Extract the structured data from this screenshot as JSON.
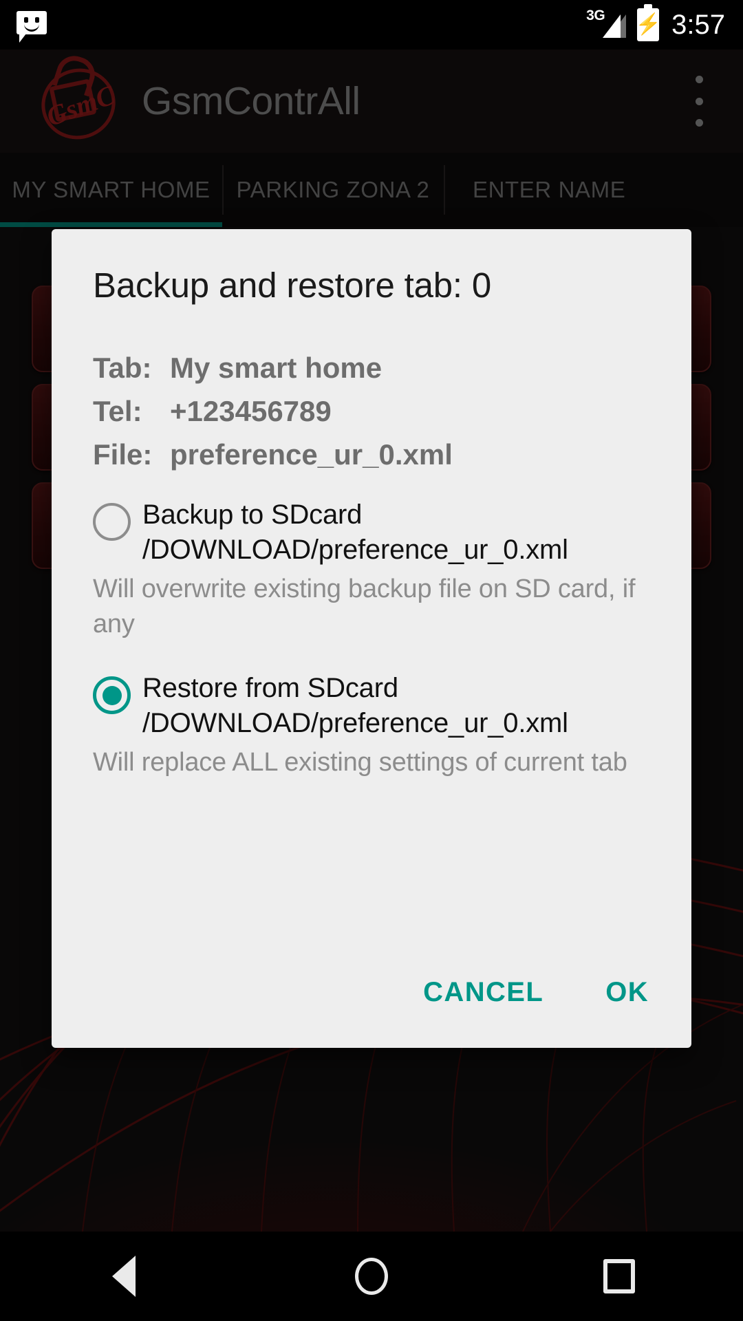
{
  "status_bar": {
    "notification_icon": "sms-icon",
    "network_label": "3G",
    "signal_icon": "signal-bars-icon",
    "battery_icon": "battery-charging-icon",
    "time": "3:57"
  },
  "app_bar": {
    "logo_text": "GsmC",
    "logo_icon": "padlock-logo-icon",
    "title": "GsmContrAll",
    "overflow_icon": "overflow-menu-icon"
  },
  "tabs": {
    "items": [
      {
        "label": "MY SMART HOME",
        "selected": true
      },
      {
        "label": "PARKING ZONA 2",
        "selected": false
      },
      {
        "label": "ENTER NAME",
        "selected": false
      }
    ],
    "indicator_color": "#00897a"
  },
  "dialog": {
    "title": "Backup and restore tab: 0",
    "info": [
      {
        "key": "Tab:",
        "value": "My smart home"
      },
      {
        "key": "Tel:",
        "value": "+123456789"
      },
      {
        "key": "File:",
        "value": "preference_ur_0.xml"
      }
    ],
    "options": [
      {
        "label": "Backup to SDcard /DOWNLOAD/preference_ur_0.xml",
        "help": "Will overwrite existing backup file on SD card, if any",
        "selected": false
      },
      {
        "label": "Restore from SDcard /DOWNLOAD/preference_ur_0.xml",
        "help": "Will replace ALL existing settings of current tab",
        "selected": true
      }
    ],
    "cancel_label": "CANCEL",
    "ok_label": "OK",
    "accent_color": "#009688",
    "background_color": "#eeeeee"
  },
  "nav_bar": {
    "back_icon": "back-triangle-icon",
    "home_icon": "home-circle-icon",
    "recents_icon": "recents-square-icon"
  }
}
